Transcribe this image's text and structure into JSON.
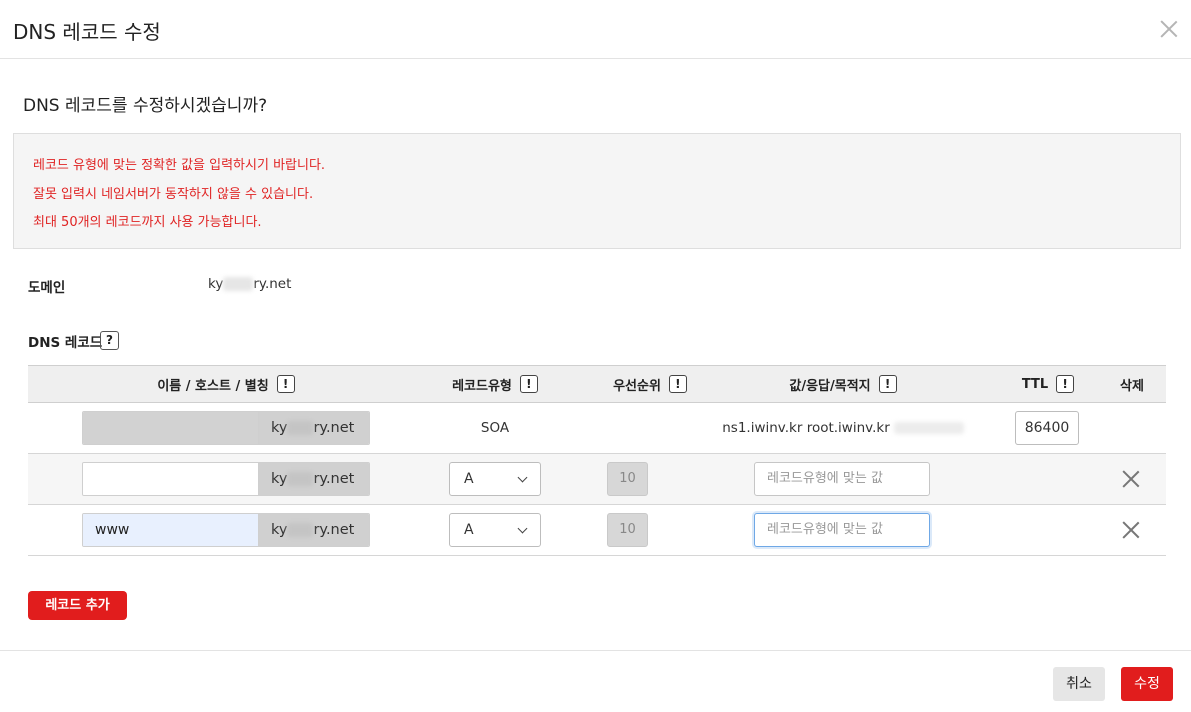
{
  "modal": {
    "title": "DNS 레코드 수정",
    "question": "DNS 레코드를 수정하시겠습니까?"
  },
  "notice": [
    "레코드 유형에 맞는 정확한 값을 입력하시기 바랍니다.",
    "잘못 입력시 네임서버가 동작하지 않을 수 있습니다.",
    "최대 50개의 레코드까지 사용 가능합니다."
  ],
  "domain": {
    "label": "도메인",
    "prefix": "ky",
    "suffix": "ry.net"
  },
  "dns_section": {
    "label": "DNS 레코드",
    "help_glyph": "?"
  },
  "table": {
    "headers": {
      "name": "이름 / 호스트 / 별칭",
      "type": "레코드유형",
      "priority": "우선순위",
      "value": "값/응답/목적지",
      "ttl": "TTL",
      "delete": "삭제"
    },
    "info_glyph": "!",
    "rows": [
      {
        "host": "",
        "suffix_prefix": "ky",
        "suffix_tail": "ry.net",
        "type": "SOA",
        "priority": "",
        "value": "ns1.iwinv.kr root.iwinv.kr",
        "ttl": "86400"
      },
      {
        "host": "",
        "suffix_prefix": "ky",
        "suffix_tail": "ry.net",
        "type": "A",
        "priority": "10",
        "value_placeholder": "레코드유형에 맞는 값"
      },
      {
        "host": "www",
        "suffix_prefix": "ky",
        "suffix_tail": "ry.net",
        "type": "A",
        "priority": "10",
        "value_placeholder": "레코드유형에 맞는 값"
      }
    ]
  },
  "buttons": {
    "add_record": "레코드 추가",
    "cancel": "취소",
    "submit": "수정"
  },
  "colors": {
    "accent": "#e11d1d",
    "notice_text": "#e02424"
  },
  "icons": [
    "close-icon",
    "help-icon",
    "info-icon",
    "chevron-down-icon",
    "delete-icon"
  ]
}
